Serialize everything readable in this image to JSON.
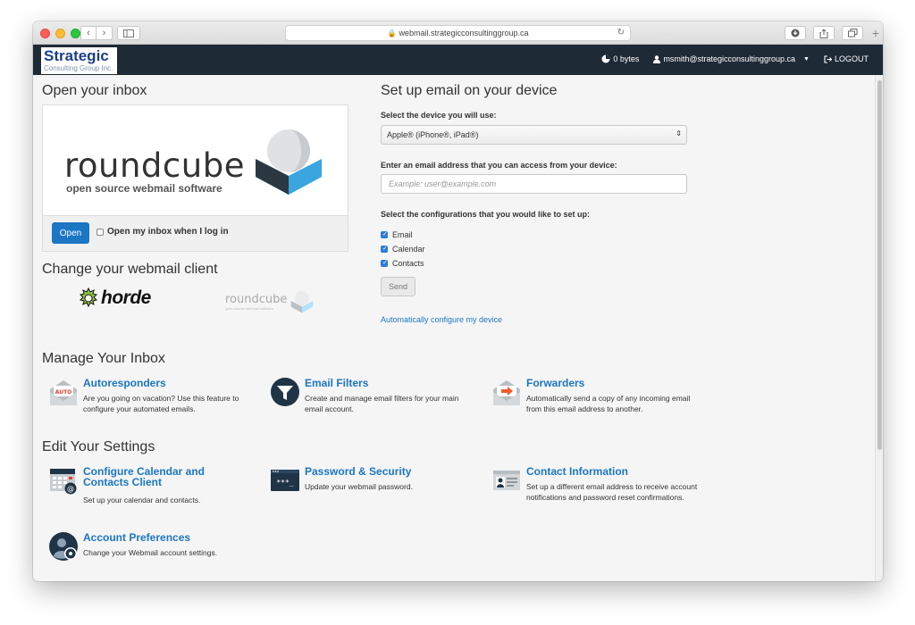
{
  "browser": {
    "url": "webmail.strategicconsultinggroup.ca"
  },
  "header": {
    "logo_main": "Strategic",
    "logo_sub": "Consulting Group Inc.",
    "disk_usage": "0 bytes",
    "user_email": "msmith@strategicconsultinggroup.ca",
    "logout": "LOGOUT"
  },
  "inbox": {
    "heading": "Open your inbox",
    "brand_word": "roundcube",
    "brand_tag": "open source webmail software",
    "open_button": "Open",
    "open_on_login_label": "Open my inbox when I log in"
  },
  "client": {
    "heading": "Change your webmail client",
    "horde_label": "horde",
    "roundcube_label": "roundcube",
    "roundcube_tag": "open source webmail software"
  },
  "device_setup": {
    "heading": "Set up email on your device",
    "device_label": "Select the device you will use:",
    "device_selected": "Apple® (iPhone®, iPad®)",
    "email_label": "Enter an email address that you can access from your device:",
    "email_placeholder": "Example: user@example.com",
    "config_label": "Select the configurations that you would like to set up:",
    "options": [
      "Email",
      "Calendar",
      "Contacts"
    ],
    "send_button": "Send",
    "auto_link": "Automatically configure my device"
  },
  "manage": {
    "heading": "Manage Your Inbox",
    "autoresponders": {
      "title": "Autoresponders",
      "icon_text": "AUTO",
      "desc": "Are you going on vacation? Use this feature to configure your automated emails."
    },
    "filters": {
      "title": "Email Filters",
      "desc": "Create and manage email filters for your main email account."
    },
    "forwarders": {
      "title": "Forwarders",
      "desc": "Automatically send a copy of any incoming email from this email address to another."
    }
  },
  "settings": {
    "heading": "Edit Your Settings",
    "calendar": {
      "title_line1": "Configure Calendar and",
      "title_line2": "Contacts Client",
      "desc": "Set up your calendar and contacts."
    },
    "password": {
      "title": "Password & Security",
      "icon_text": "***_",
      "desc": "Update your webmail password."
    },
    "contact": {
      "title": "Contact Information",
      "desc": "Set up a different email address to receive account notifications and password reset confirmations."
    },
    "preferences": {
      "title": "Account Preferences",
      "desc": "Change your Webmail account settings."
    }
  },
  "colors": {
    "accent": "#1b76c4",
    "topbar": "#1e2a36",
    "logo_blue": "#1c3f87"
  }
}
